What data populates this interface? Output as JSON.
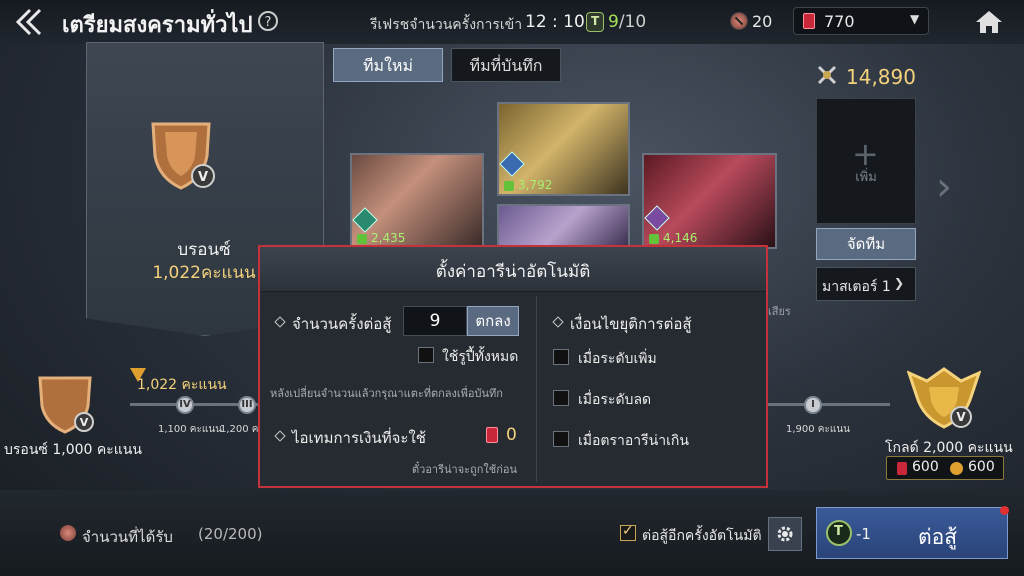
{
  "header": {
    "title": "เตรียมสงครามทั่วไป",
    "help_label": "?",
    "refresh_label": "รีเฟรชจำนวนครั้งการเข้า",
    "refresh_time": "12 : 10",
    "tickets_current": "9",
    "tickets_max": "/10",
    "medals": "20",
    "gems": "770"
  },
  "left_card": {
    "rank_name": "บรอนซ์",
    "rank_score": "1,022คะแนน"
  },
  "team_tabs": [
    "ทีมใหม่",
    "ทีมที่บันทึก"
  ],
  "heroes": [
    {
      "power": "2,435"
    },
    {
      "power": "3,792"
    },
    {
      "power": "4,146"
    }
  ],
  "right_panel": {
    "team_power": "14,890",
    "add_label": "เพิ่ม",
    "arrange_label": "จัดทีม",
    "master_label": "มาสเตอร์ 1",
    "hint_text": "เสียร"
  },
  "rank_track": {
    "current_rank_label": "บรอนซ์ 1,000 คะแนน",
    "current_score": "1,022 คะแนน",
    "tiers": [
      {
        "numeral": "IV",
        "score": "1,100 คะแนน"
      },
      {
        "numeral": "III",
        "score": "1,200 คะ"
      },
      {
        "numeral": "I",
        "score": "1,900 คะแนน"
      }
    ],
    "next_rank_label": "โกลด์ 2,000 คะแนน",
    "reward_gems": "600",
    "reward_gold": "600"
  },
  "bottom": {
    "received_label": "จำนวนที่ได้รับ",
    "received_count": "(20/200)",
    "auto_label": "ต่อสู้อีกครั้งอัตโนมัติ",
    "fight_cost": "-1",
    "fight_label": "ต่อสู้"
  },
  "modal": {
    "title": "ตั้งค่าอารีน่าอัตโนมัติ",
    "battle_count_label": "จำนวนครั้งต่อสู้",
    "battle_count_value": "9",
    "confirm_label": "ตกลง",
    "use_all_label": "ใช้รูปี้ทั้งหมด",
    "note": "หลังเปลี่ยนจำนวนแล้วกรุณาแตะที่ตกลงเพื่อบันทึก",
    "currency_item_label": "ไอเทมการเงินที่จะใช้",
    "currency_item_count": "0",
    "currency_note": "ตั๋วอารีน่าจะถูกใช้ก่อน",
    "stop_title": "เงื่อนไขยุติการต่อสู้",
    "stop_options": [
      "เมื่อระดับเพิ่ม",
      "เมื่อระดับลด",
      "เมื่อตราอารีน่าเกิน"
    ]
  },
  "colors": {
    "accent_gold": "#f4d27c",
    "modal_border": "#c4333c",
    "ticket_green": "#a6e05a",
    "button_blue": "#5a6a80"
  }
}
